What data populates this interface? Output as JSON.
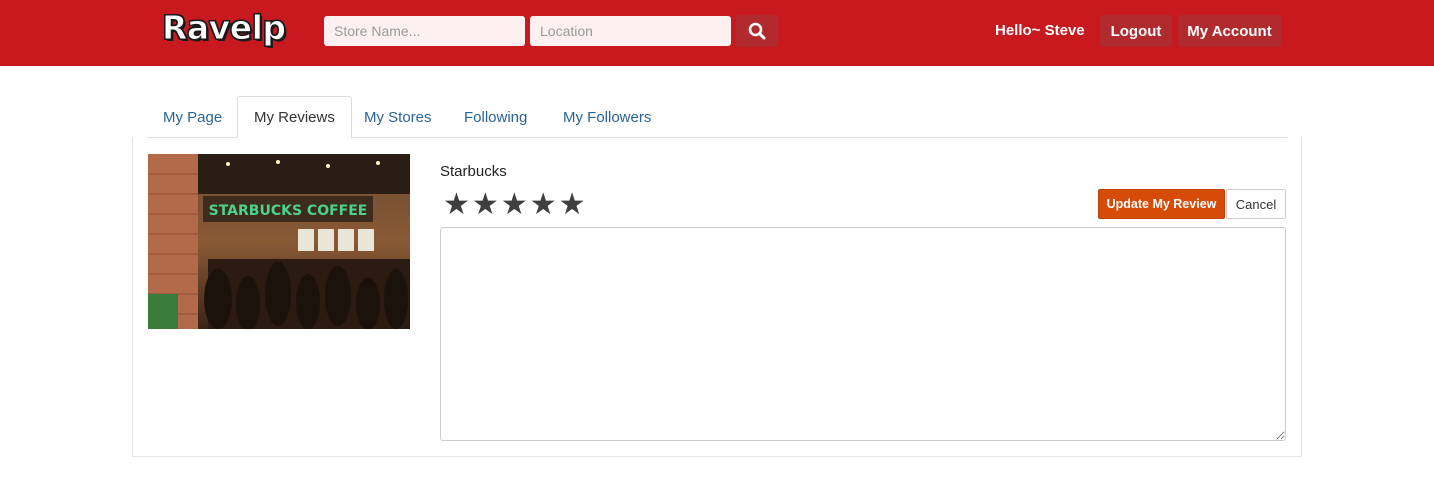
{
  "header": {
    "logo_text": "Ravelp",
    "store_placeholder": "Store Name...",
    "location_placeholder": "Location",
    "search_icon": "search-icon",
    "greeting": "Hello~ Steve",
    "logout_label": "Logout",
    "account_label": "My Account",
    "brand_color": "#c8191e"
  },
  "tabs": [
    {
      "label": "My Page",
      "active": false
    },
    {
      "label": "My Reviews",
      "active": true
    },
    {
      "label": "My Stores",
      "active": false
    },
    {
      "label": "Following",
      "active": false
    },
    {
      "label": "My Followers",
      "active": false
    }
  ],
  "review": {
    "store_name": "Starbucks",
    "photo_sign_text": "STARBUCKS COFFEE",
    "rating": 5,
    "rating_max": 5,
    "star_glyph": "★",
    "review_text": "",
    "update_label": "Update My Review",
    "cancel_label": "Cancel",
    "update_color": "#d64b08"
  }
}
